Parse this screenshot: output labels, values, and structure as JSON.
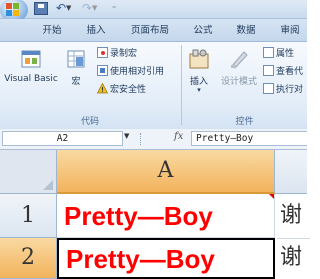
{
  "tabs": [
    "开始",
    "插入",
    "页面布局",
    "公式",
    "数据",
    "审阅"
  ],
  "ribbon": {
    "code_group": {
      "label": "代码",
      "visual_basic": "Visual Basic",
      "macros": "宏",
      "record_macro": "录制宏",
      "relative_ref": "使用相对引用",
      "macro_security": "宏安全性"
    },
    "controls_group": {
      "label": "控件",
      "insert": "插入",
      "design_mode": "设计模式",
      "properties": "属性",
      "view_code": "查看代",
      "run_dialog": "执行对"
    }
  },
  "formula_bar": {
    "name_box": "A2",
    "fx": "fx",
    "formula": "Pretty—Boy"
  },
  "grid": {
    "col_a": "A",
    "row1": "1",
    "row2": "2",
    "a1": "Pretty—Boy",
    "a2": "Pretty—Boy",
    "b1": "谢",
    "b2": "谢"
  },
  "colors": {
    "cell_text": "#ff0000",
    "selected_header": "#f2b35c",
    "ribbon_bg": "#e3edf8"
  }
}
